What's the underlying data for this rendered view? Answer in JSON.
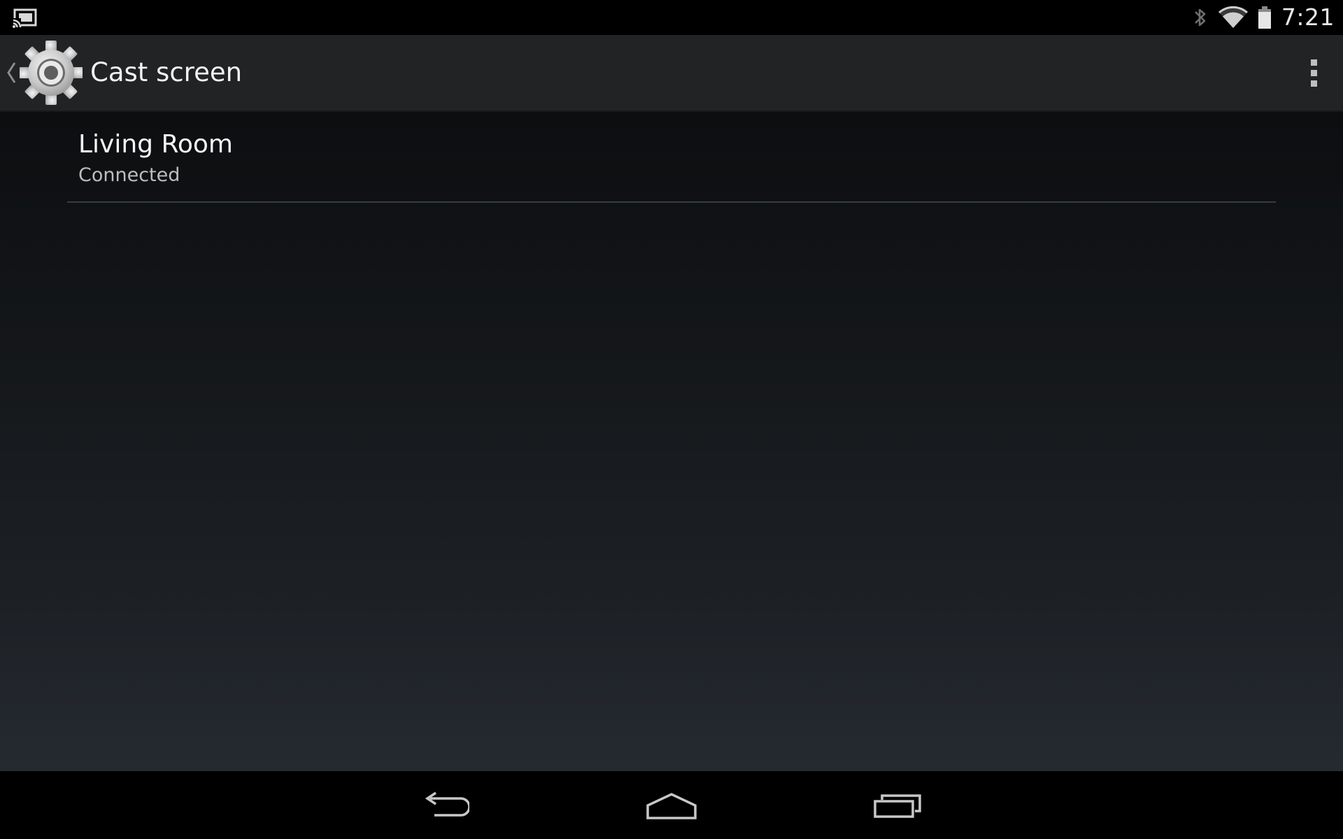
{
  "status_bar": {
    "time": "7:21",
    "icons": [
      "cast-icon",
      "bluetooth-icon",
      "wifi-icon",
      "battery-icon"
    ]
  },
  "action_bar": {
    "title": "Cast screen",
    "app_icon": "settings-gear-icon",
    "overflow_icon": "overflow-menu-icon"
  },
  "devices": [
    {
      "name": "Living Room",
      "status": "Connected"
    }
  ],
  "nav_bar": {
    "icons": [
      "back-icon",
      "home-icon",
      "recents-icon"
    ]
  },
  "colors": {
    "status_bar_bg": "#000000",
    "action_bar_bg": "#222324",
    "content_top": "#0c0e10",
    "content_bottom": "#252a31",
    "primary_text": "#f5f5f5",
    "secondary_text": "#bdbdbd",
    "divider": "#3a3d40"
  }
}
